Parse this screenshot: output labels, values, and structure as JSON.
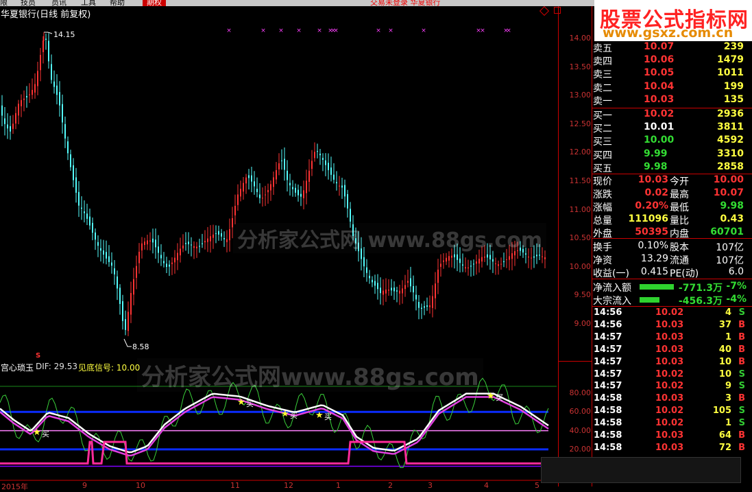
{
  "menu": {
    "items": [
      "限",
      "技员",
      "员讯",
      "工具",
      "帮助"
    ],
    "active": "期权",
    "title": "交易未登录 华夏银行"
  },
  "stock_title": "华夏银行(日线 前复权)",
  "price_axis": [
    "14.00",
    "13.50",
    "13.00",
    "12.50",
    "12.00",
    "11.50",
    "11.00",
    "10.50",
    "10.00",
    "9.50",
    "9.00"
  ],
  "indicator_axis": [
    "80.00",
    "60.00",
    "40.00",
    "20.00"
  ],
  "high_label": "14.15",
  "low_label": "8.58",
  "signal_label": "S",
  "indicator": {
    "name": "宫心琐玉",
    "dif_label": "DIF: 29.53",
    "signal_label": "见底信号: 10.00",
    "buy_marker": "买"
  },
  "x_axis": [
    "2015年",
    "9",
    "10",
    "11",
    "12",
    "1",
    "2",
    "3",
    "4",
    "5"
  ],
  "watermarks": {
    "top": "分析家公式网 www.88gs.com",
    "bottom": "分析家公式网www.88gs.com",
    "logo_main": "股票公式指标网",
    "logo_url": "www.gsxz.com.cn"
  },
  "order_book": [
    {
      "label": "卖五",
      "price": "10.07",
      "vol": "239"
    },
    {
      "label": "卖四",
      "price": "10.06",
      "vol": "1479"
    },
    {
      "label": "卖三",
      "price": "10.05",
      "vol": "1011"
    },
    {
      "label": "卖二",
      "price": "10.04",
      "vol": "199"
    },
    {
      "label": "卖一",
      "price": "10.03",
      "vol": "135"
    },
    {
      "label": "买一",
      "price": "10.02",
      "vol": "2936"
    },
    {
      "label": "买二",
      "price": "10.01",
      "vol": "3811"
    },
    {
      "label": "买三",
      "price": "10.00",
      "vol": "4592"
    },
    {
      "label": "买四",
      "price": "9.99",
      "vol": "3310"
    },
    {
      "label": "买五",
      "price": "9.98",
      "vol": "2858"
    }
  ],
  "quote": [
    {
      "l1": "现价",
      "v1": "10.03",
      "l2": "今开",
      "v2": "10.00"
    },
    {
      "l1": "涨跌",
      "v1": "0.02",
      "l2": "最高",
      "v2": "10.07"
    },
    {
      "l1": "涨幅",
      "v1": "0.20%",
      "l2": "最低",
      "v2": "9.98"
    },
    {
      "l1": "总量",
      "v1": "111096",
      "l2": "量比",
      "v2": "0.43"
    },
    {
      "l1": "外盘",
      "v1": "50395",
      "l2": "内盘",
      "v2": "60701"
    }
  ],
  "stats": [
    {
      "l1": "换手",
      "v1": "0.10%",
      "l2": "股本",
      "v2": "107亿"
    },
    {
      "l1": "净资",
      "v1": "13.29",
      "l2": "流通",
      "v2": "107亿"
    },
    {
      "l1": "收益(一)",
      "v1": "0.415",
      "l2": "PE(动)",
      "v2": "6.0"
    }
  ],
  "flows": [
    {
      "label": "净流入额",
      "value": "-771.3万",
      "pct": "-7%",
      "bar": 0.7
    },
    {
      "label": "大宗流入",
      "value": "-456.3万",
      "pct": "-4%",
      "bar": 0.4
    }
  ],
  "ticks": [
    {
      "t": "14:56",
      "p": "10.02",
      "v": "4",
      "s": "S"
    },
    {
      "t": "14:56",
      "p": "10.03",
      "v": "37",
      "s": "B"
    },
    {
      "t": "14:57",
      "p": "10.03",
      "v": "1",
      "s": "B"
    },
    {
      "t": "14:57",
      "p": "10.03",
      "v": "40",
      "s": "B"
    },
    {
      "t": "14:57",
      "p": "10.03",
      "v": "10",
      "s": "B"
    },
    {
      "t": "14:57",
      "p": "10.02",
      "v": "10",
      "s": "S"
    },
    {
      "t": "14:57",
      "p": "10.02",
      "v": "9",
      "s": "S"
    },
    {
      "t": "14:58",
      "p": "10.03",
      "v": "3",
      "s": "B"
    },
    {
      "t": "14:58",
      "p": "10.02",
      "v": "105",
      "s": "S"
    },
    {
      "t": "14:58",
      "p": "10.02",
      "v": "1",
      "s": "S"
    },
    {
      "t": "14:58",
      "p": "10.03",
      "v": "64",
      "s": "B"
    },
    {
      "t": "14:58",
      "p": "10.03",
      "v": "72",
      "s": "B"
    }
  ],
  "colors": {
    "up": "#ff3333",
    "down": "#54ffff",
    "sell_b": "#ff3333",
    "sell_s": "#33cc33"
  }
}
